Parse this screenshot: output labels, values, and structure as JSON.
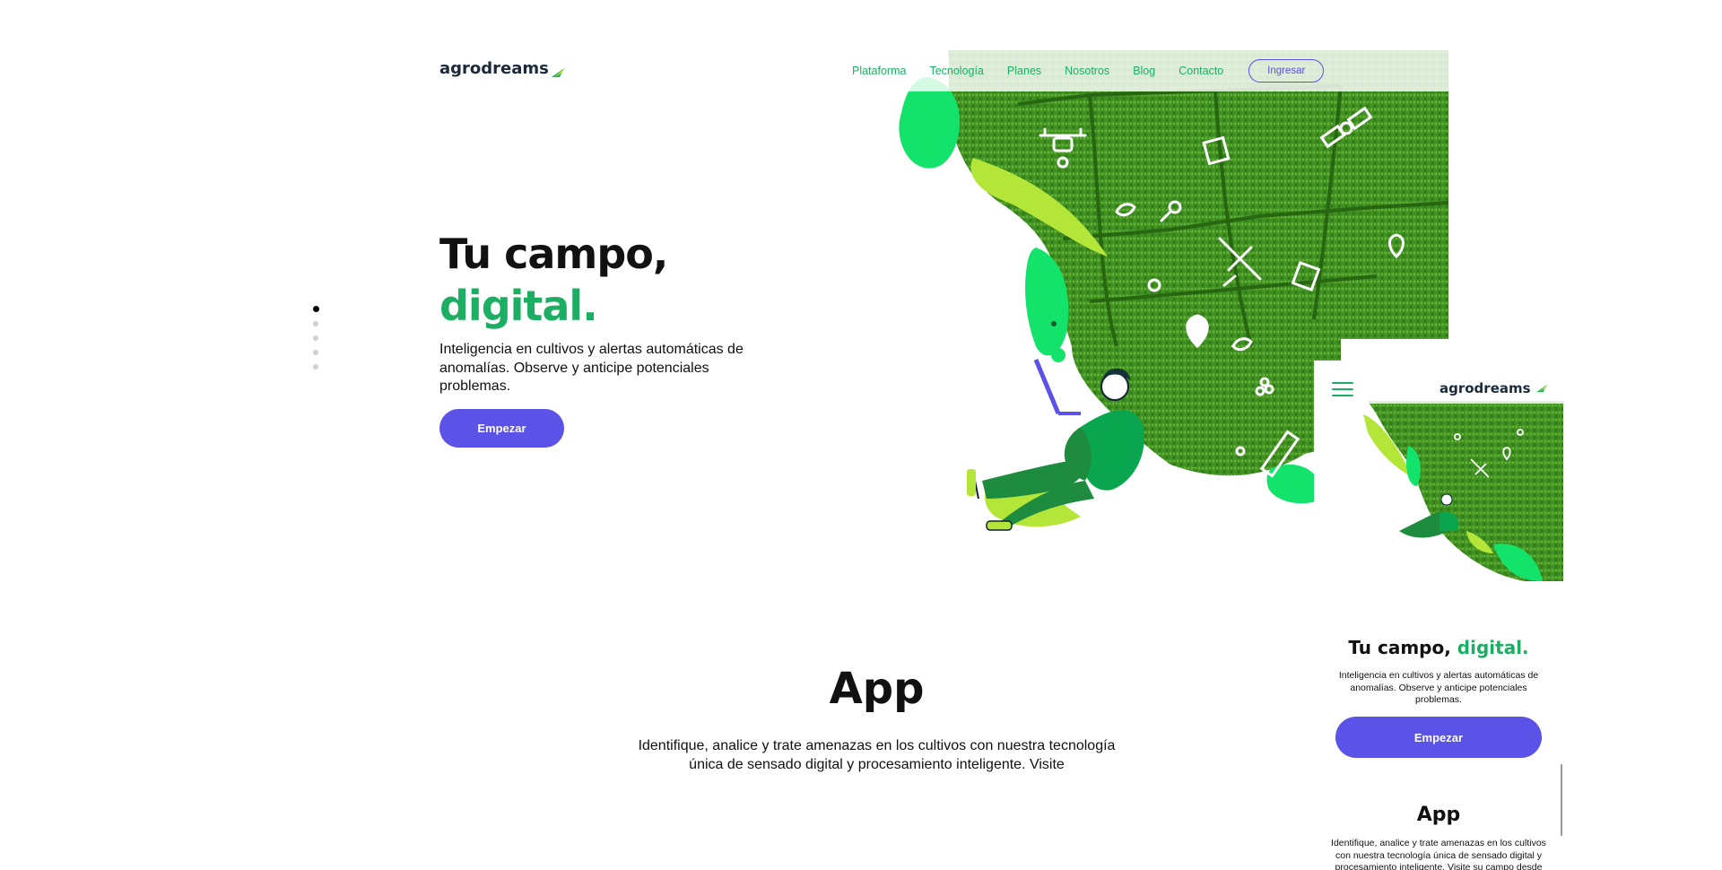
{
  "brand": {
    "name": "agrodreams",
    "color_primary": "#1cae63",
    "color_accent": "#5b52e7"
  },
  "nav": {
    "items": [
      "Plataforma",
      "Tecnología",
      "Planes",
      "Nosotros",
      "Blog",
      "Contacto"
    ],
    "login_label": "Ingresar"
  },
  "hero": {
    "title_line1": "Tu campo,",
    "title_line2": "digital.",
    "subtitle": "Inteligencia en cultivos y alertas automáticas de anomalías. Observe y anticipe potenciales problemas.",
    "cta_label": "Empezar",
    "slide_count": 5,
    "active_slide": 1
  },
  "app_section": {
    "title": "App",
    "description": "Identifique, analice y trate amenazas en los cultivos con nuestra tecnología única de sensado digital y procesamiento inteligente. Visite"
  },
  "mobile": {
    "logo": "agrodreams",
    "title_part1": "Tu campo,",
    "title_part2": "digital.",
    "subtitle": "Inteligencia en cultivos y alertas automáticas de anomalías. Observe y anticipe potenciales problemas.",
    "cta_label": "Empezar",
    "app_title": "App",
    "app_description": "Identifique, analice y trate amenazas en los cultivos con nuestra tecnología única de sensado digital y procesamiento inteligente. Visite su campo desde"
  },
  "icons": [
    "drone-icon",
    "satellite-icon",
    "airplane-icon",
    "location-pin-icon",
    "leaf-icon",
    "clipboard-icon",
    "gear-icon",
    "bugs-icon",
    "ruler-icon",
    "hamburger-menu-icon"
  ]
}
